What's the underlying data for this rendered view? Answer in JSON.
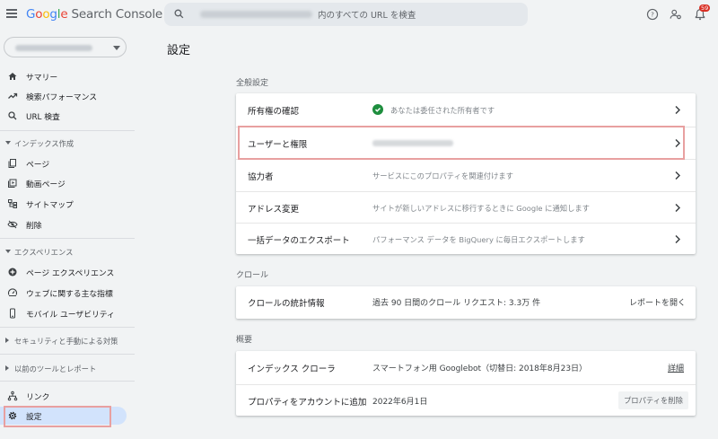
{
  "header": {
    "logo_google": "Google",
    "logo_product": "Search Console",
    "search_placeholder": "内のすべての URL を検査",
    "notification_count": "59"
  },
  "sidebar": {
    "items_top": [
      {
        "label": "サマリー",
        "icon": "home-icon"
      },
      {
        "label": "検索パフォーマンス",
        "icon": "trending-up-icon"
      },
      {
        "label": "URL 検査",
        "icon": "search-icon"
      }
    ],
    "index_section": {
      "label": "インデックス作成"
    },
    "index_items": [
      {
        "label": "ページ",
        "icon": "pages-icon"
      },
      {
        "label": "動画ページ",
        "icon": "video-page-icon"
      },
      {
        "label": "サイトマップ",
        "icon": "sitemap-icon"
      },
      {
        "label": "削除",
        "icon": "removal-icon"
      }
    ],
    "experience_section": {
      "label": "エクスペリエンス"
    },
    "experience_items": [
      {
        "label": "ページ エクスペリエンス",
        "icon": "plus-circle-icon"
      },
      {
        "label": "ウェブに関する主な指標",
        "icon": "gauge-icon"
      },
      {
        "label": "モバイル ユーザビリティ",
        "icon": "phone-icon"
      }
    ],
    "security_section": {
      "label": "セキュリティと手動による対策"
    },
    "legacy_section": {
      "label": "以前のツールとレポート"
    },
    "items_bottom": [
      {
        "label": "リンク",
        "icon": "links-icon"
      },
      {
        "label": "設定",
        "icon": "gear-icon"
      }
    ]
  },
  "main": {
    "page_title": "設定",
    "general": {
      "title": "全般設定",
      "rows": [
        {
          "key": "所有権の確認",
          "value": "あなたは委任された所有者です"
        },
        {
          "key": "ユーザーと権限",
          "value": ""
        },
        {
          "key": "協力者",
          "value": "サービスにこのプロパティを関連付けます"
        },
        {
          "key": "アドレス変更",
          "value": "サイトが新しいアドレスに移行するときに Google に通知します"
        },
        {
          "key": "一括データのエクスポート",
          "value": "パフォーマンス データを BigQuery に毎日エクスポートします"
        }
      ]
    },
    "crawl": {
      "title": "クロール",
      "row": {
        "key": "クロールの統計情報",
        "value": "過去 90 日間のクロール リクエスト: 3.3万 件",
        "action": "レポートを開く"
      }
    },
    "about": {
      "title": "概要",
      "rows": [
        {
          "key": "インデックス クローラ",
          "value": "スマートフォン用 Googlebot（切替日: 2018年8月23日）",
          "action": "詳細"
        },
        {
          "key": "プロパティをアカウントに追加",
          "value": "2022年6月1日",
          "action": "プロパティを削除"
        }
      ]
    }
  },
  "colors": {
    "background": "#f1f3f4",
    "active_nav": "#d2e3fc",
    "highlight_box": "#e8a0a0",
    "success_green": "#1e8e3e",
    "badge_red": "#d93025"
  }
}
